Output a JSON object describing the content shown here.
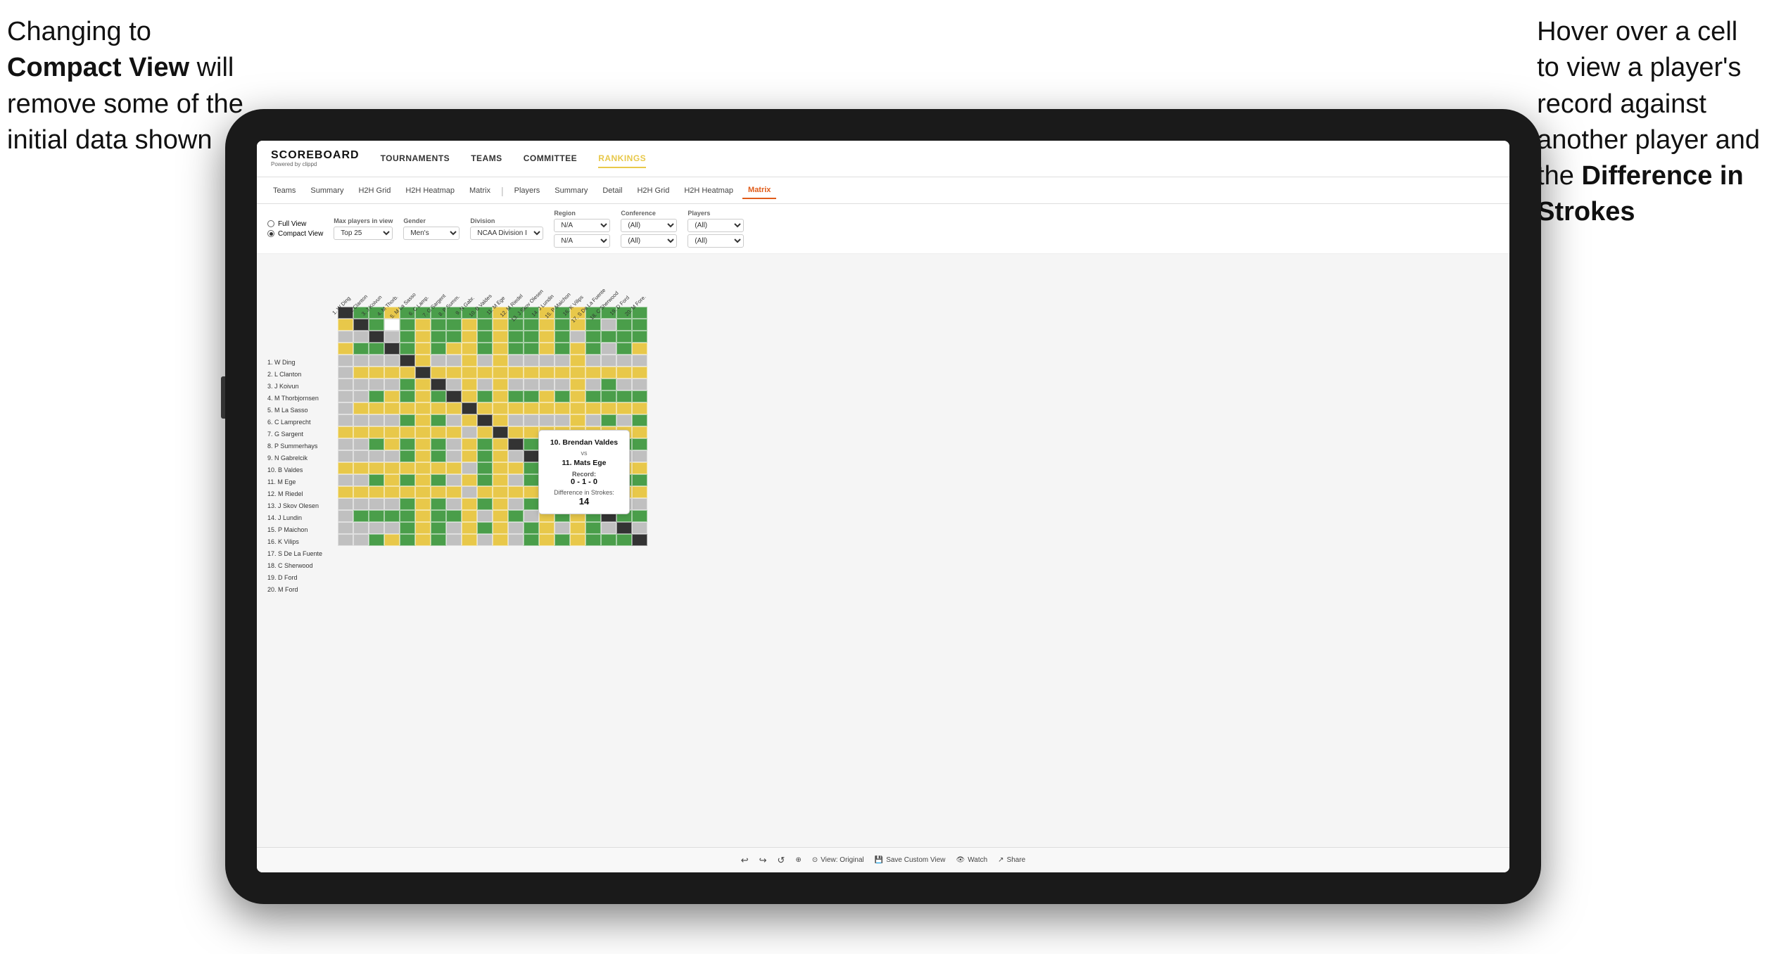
{
  "annotations": {
    "left": {
      "line1": "Changing to",
      "line2_bold": "Compact View",
      "line2_normal": " will",
      "line3": "remove some of the",
      "line4": "initial data shown"
    },
    "right": {
      "line1": "Hover over a cell",
      "line2": "to view a player's",
      "line3": "record against",
      "line4": "another player and",
      "line5_pre": "the ",
      "line5_bold": "Difference in",
      "line6_bold": "Strokes"
    }
  },
  "app": {
    "logo": "SCOREBOARD",
    "logo_sub": "Powered by clippd",
    "nav_items": [
      "TOURNAMENTS",
      "TEAMS",
      "COMMITTEE",
      "RANKINGS"
    ],
    "sub_tabs_left": [
      "Teams",
      "Summary",
      "H2H Grid",
      "H2H Heatmap",
      "Matrix"
    ],
    "sub_tabs_right": [
      "Players",
      "Summary",
      "Detail",
      "H2H Grid",
      "H2H Heatmap",
      "Matrix"
    ],
    "active_sub_tab": "Matrix"
  },
  "filters": {
    "view_options": [
      "Full View",
      "Compact View"
    ],
    "active_view": "Compact View",
    "max_players_label": "Max players in view",
    "max_players_value": "Top 25",
    "gender_label": "Gender",
    "gender_value": "Men's",
    "division_label": "Division",
    "division_value": "NCAA Division I",
    "region_label": "Region",
    "region_values": [
      "N/A",
      "N/A"
    ],
    "conference_label": "Conference",
    "conference_values": [
      "(All)",
      "(All)"
    ],
    "players_label": "Players",
    "players_values": [
      "(All)",
      "(All)"
    ]
  },
  "tooltip": {
    "player1": "10. Brendan Valdes",
    "vs": "vs",
    "player2": "11. Mats Ege",
    "record_label": "Record:",
    "record": "0 - 1 - 0",
    "diff_label": "Difference in Strokes:",
    "diff": "14"
  },
  "row_players": [
    "1. W Ding",
    "2. L Clanton",
    "3. J Koivun",
    "4. M Thorbjornsen",
    "5. M La Sasso",
    "6. C Lamprecht",
    "7. G Sargent",
    "8. P Summerhays",
    "9. N Gabrelcik",
    "10. B Valdes",
    "11. M Ege",
    "12. M Riedel",
    "13. J Skov Olesen",
    "14. J Lundin",
    "15. P Maichon",
    "16. K Vilips",
    "17. S De La Fuente",
    "18. C Sherwood",
    "19. D Ford",
    "20. M Ford"
  ],
  "col_headers": [
    "1. W Ding",
    "2. L Clanton",
    "3. J Koivun",
    "4. M Thorb.",
    "5. M La Sasso",
    "6. C Lamp.",
    "7. G Sargent",
    "8. P Summ.",
    "9. N Gabr.",
    "10. B Valdes",
    "11. M Ege",
    "12. M Riedel",
    "13. J Skov Olesen",
    "14. J Lundin",
    "15. P Maichon",
    "16. K Vilips",
    "17. S De La Fuente",
    "18. C Sherwood",
    "19. D Ford",
    "20. M Fore."
  ],
  "toolbar": {
    "view_original": "View: Original",
    "save_custom": "Save Custom View",
    "watch": "Watch",
    "share": "Share"
  }
}
